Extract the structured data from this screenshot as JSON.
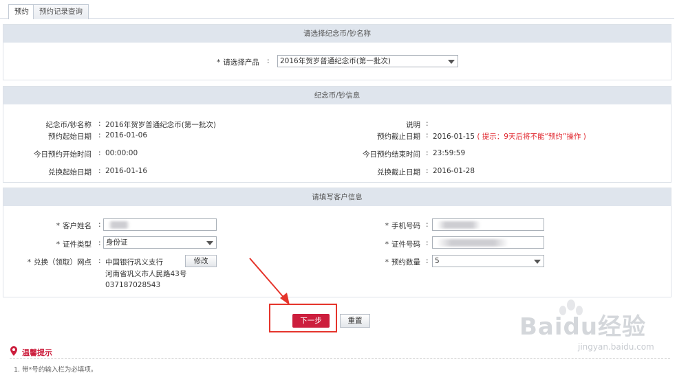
{
  "tabs": [
    "预约",
    "预约记录查询"
  ],
  "section1": {
    "title": "请选择纪念币/钞名称",
    "product_label": "请选择产品",
    "product_value": "2016年贺岁普通纪念币(第一批次)"
  },
  "section2": {
    "title": "纪念币/钞信息",
    "name_label": "纪念币/钞名称",
    "name_value": "2016年贺岁普通纪念币(第一批次)",
    "desc_label": "说明",
    "start_label": "预约起始日期",
    "start_value": "2016-01-06",
    "end_label": "预约截止日期",
    "end_value": "2016-01-15",
    "end_hint": "( 提示：9天后将不能“预约”操作 )",
    "today_start_label": "今日预约开始时间",
    "today_start_value": "00:00:00",
    "today_end_label": "今日预约结束时间",
    "today_end_value": "23:59:59",
    "exchange_start_label": "兑换起始日期",
    "exchange_start_value": "2016-01-16",
    "exchange_end_label": "兑换截止日期",
    "exchange_end_value": "2016-01-28"
  },
  "section3": {
    "title": "请填写客户信息",
    "customer_name_label": "客户姓名",
    "phone_label": "手机号码",
    "id_type_label": "证件类型",
    "id_type_value": "身份证",
    "id_number_label": "证件号码",
    "branch_label": "兑换（领取）网点",
    "branch_name": "中国银行巩义支行",
    "branch_address": "河南省巩义市人民路43号",
    "branch_phone": "037187028543",
    "modify_button": "修改",
    "quantity_label": "预约数量",
    "quantity_value": "5"
  },
  "actions": {
    "next": "下一步",
    "reset": "重置"
  },
  "tips": {
    "title": "温馨提示",
    "line1": "1. 带*号的输入栏为必填项。"
  },
  "watermark": {
    "brand": "Baidu经验",
    "url": "jingyan.baidu.com"
  },
  "colors": {
    "accent": "#cc1e3d",
    "panel_header": "#dfe5ed",
    "annotation": "#e5342b"
  }
}
